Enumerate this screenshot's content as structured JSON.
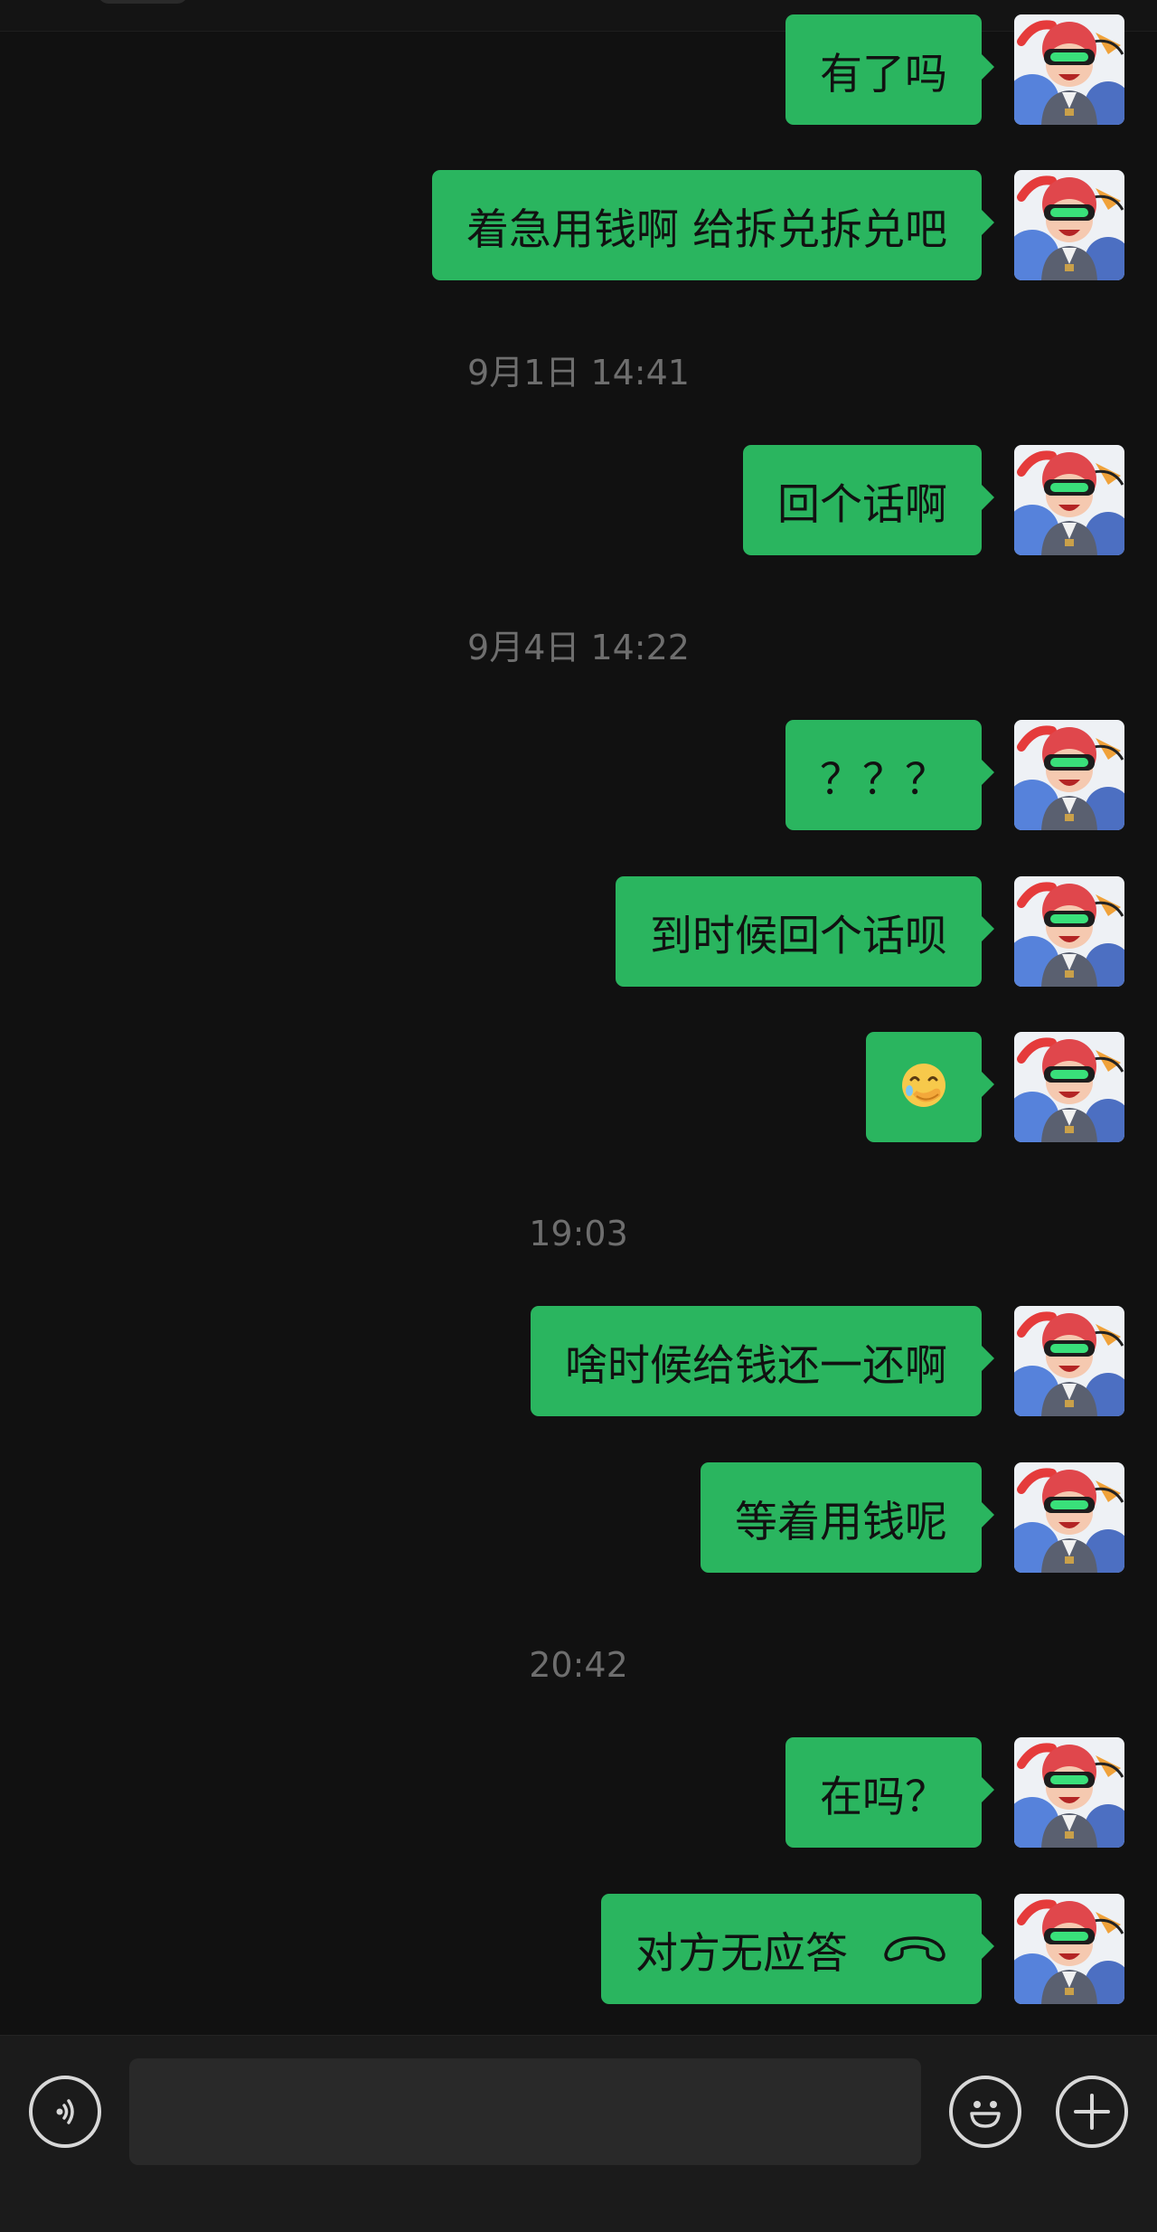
{
  "chat": {
    "messages": [
      {
        "text": "有了吗"
      },
      {
        "text": "着急用钱啊 给拆兑拆兑吧"
      },
      {
        "text": "回个话啊"
      },
      {
        "text": "？？？"
      },
      {
        "text": "到时候回个话呗"
      },
      {
        "emoji": "face-with-hand-over-mouth-emoji"
      },
      {
        "text": "啥时候给钱还一还啊"
      },
      {
        "text": "等着用钱呢"
      },
      {
        "text": "在吗？"
      },
      {
        "text": "对方无应答",
        "icon": "hang-up-phone-icon"
      }
    ],
    "timestamps": [
      "9月1日 14:41",
      "9月4日 14:22",
      "19:03",
      "20:42"
    ]
  },
  "input_bar": {
    "message_value": "",
    "voice_icon": "voice-input-icon",
    "emoji_icon": "emoji-smiley-icon",
    "more_icon": "plus-circle-icon"
  },
  "colors": {
    "background": "#111111",
    "bubble": "#2ab55f",
    "bubble_text": "#111111",
    "timestamp_text": "#6e6e6e",
    "input_bar_bg": "#1b1b1b"
  }
}
